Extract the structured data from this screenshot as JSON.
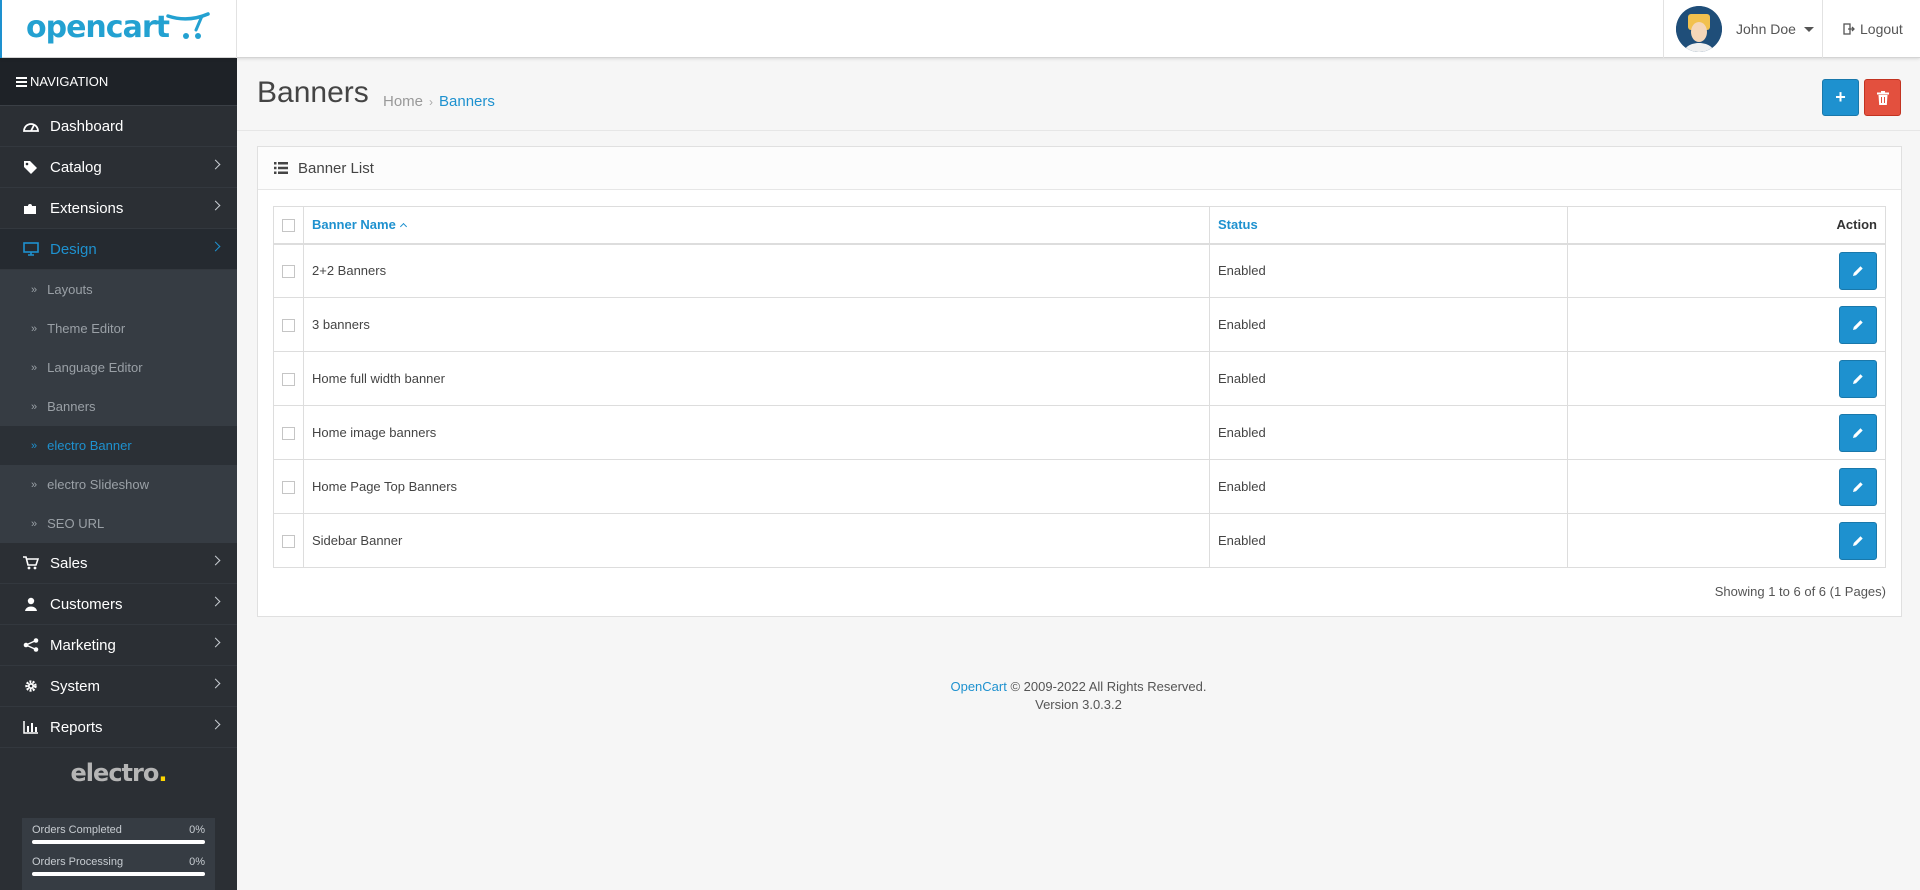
{
  "header": {
    "logo": "opencart",
    "user_name": "John Doe",
    "logout_label": "Logout"
  },
  "sidebar": {
    "nav_title": "NAVIGATION",
    "items": [
      {
        "label": "Dashboard",
        "icon": "dashboard-icon"
      },
      {
        "label": "Catalog",
        "icon": "tags-icon"
      },
      {
        "label": "Extensions",
        "icon": "puzzle-icon"
      },
      {
        "label": "Design",
        "icon": "desktop-icon"
      },
      {
        "label": "Sales",
        "icon": "shopping-cart-icon"
      },
      {
        "label": "Customers",
        "icon": "user-icon"
      },
      {
        "label": "Marketing",
        "icon": "share-icon"
      },
      {
        "label": "System",
        "icon": "gear-icon"
      },
      {
        "label": "Reports",
        "icon": "bar-chart-icon"
      }
    ],
    "design_submenu": [
      {
        "label": "Layouts"
      },
      {
        "label": "Theme Editor"
      },
      {
        "label": "Language Editor"
      },
      {
        "label": "Banners"
      },
      {
        "label": "electro Banner"
      },
      {
        "label": "electro Slideshow"
      },
      {
        "label": "SEO URL"
      }
    ],
    "brand": {
      "text": "electro",
      "dot": "."
    },
    "progress": [
      {
        "label": "Orders Completed",
        "percent": "0%",
        "value": 0
      },
      {
        "label": "Orders Processing",
        "percent": "0%",
        "value": 0
      }
    ]
  },
  "page": {
    "title": "Banners",
    "breadcrumb": {
      "home": "Home",
      "sep": "›",
      "current": "Banners"
    },
    "add_button": "+",
    "panel_title": "Banner List",
    "table": {
      "headers": {
        "name": "Banner Name",
        "status": "Status",
        "action": "Action"
      },
      "rows": [
        {
          "name": "2+2 Banners",
          "status": "Enabled"
        },
        {
          "name": "3 banners",
          "status": "Enabled"
        },
        {
          "name": "Home full width banner",
          "status": "Enabled"
        },
        {
          "name": "Home image banners",
          "status": "Enabled"
        },
        {
          "name": "Home Page Top Banners",
          "status": "Enabled"
        },
        {
          "name": "Sidebar Banner",
          "status": "Enabled"
        }
      ]
    },
    "pagination_text": "Showing 1 to 6 of 6 (1 Pages)"
  },
  "footer": {
    "link": "OpenCart",
    "copyright": " © 2009-2022 All Rights Reserved.",
    "version": "Version 3.0.3.2"
  },
  "colors": {
    "primary": "#1e91cf",
    "danger": "#e3503e",
    "sidebar_bg": "#2b2f34"
  }
}
